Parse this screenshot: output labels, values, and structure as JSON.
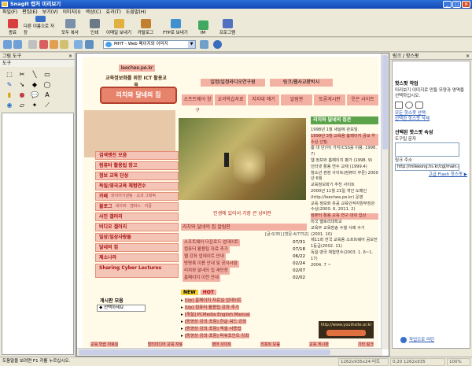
{
  "title": "SnagIt 캡처 미리보기",
  "window_buttons": [
    "_",
    "□",
    "×"
  ],
  "menu": [
    "파일(F)",
    "편집(E)",
    "보기(V)",
    "이미지(I)",
    "색상(C)",
    "효과(T)",
    "도움말(H)"
  ],
  "toolbar": {
    "buttons": [
      {
        "label": "종료",
        "icon": "exit-icon",
        "color": "#d84040"
      },
      {
        "label": "다른 이름으로 저장",
        "icon": "save-as-icon",
        "color": "#3a70c8"
      },
      {
        "label": "모두 복사",
        "icon": "copy-all-icon",
        "color": "#7a8fa8"
      },
      {
        "label": "인쇄",
        "icon": "print-icon",
        "color": "#6c7a88"
      },
      {
        "label": "이메일 보내기",
        "icon": "email-icon",
        "color": "#e0b040"
      },
      {
        "label": "카탈로그",
        "icon": "catalog-icon",
        "color": "#c08030"
      },
      {
        "label": "FTP로 보내기",
        "icon": "ftp-icon",
        "color": "#4090d0"
      },
      {
        "label": "IM",
        "icon": "im-icon",
        "color": "#40a860"
      },
      {
        "label": "프로그램",
        "icon": "program-icon",
        "color": "#5070c0"
      }
    ],
    "format_select": "MHT - Web 페이지와 이미지"
  },
  "left_panel": {
    "title": "그림 도구",
    "group": "도구",
    "tools": [
      "select-icon",
      "crop-icon",
      "line-icon",
      "rectangle-icon",
      "pencil-icon",
      "arrow-icon",
      "shape-icon",
      "ellipse-icon",
      "highlighter-icon",
      "stamp-icon",
      "callout-icon",
      "text-icon",
      "fill-icon",
      "eraser-icon",
      "magic-wand-icon",
      "eyedropper-icon",
      "color-icon",
      "more-icon"
    ]
  },
  "right_panel": {
    "title": "링크 / 핫스팟",
    "section1_title": "핫스팟 작업",
    "section1_desc": "미리보기 이미지로 만들 모양과 영역을 선택하십시오.",
    "links": [
      "모든 핫스팟 선택",
      "선택한 핫스팟 삭제"
    ],
    "section2_title": "선택된 핫스팟 속성",
    "tooltip_label": "도구팁 문자",
    "link_label": "링크 주소",
    "link_value": "http://mileeong.hs.kr/cgi/main.cgi?bl",
    "advanced": "고급 Flash 핫스팟 ▶",
    "footer_link": "작업으로 리턴"
  },
  "website": {
    "site_label": "leechee.pe.kr",
    "tagline": "교육정보화를 위한 ICT 활용교육",
    "logo": "리치와 달네의 집",
    "nav": [
      "일정/일정라디오연구원",
      "링크/웹사교환박시"
    ],
    "tabs": [
      "소프트웨어 창구",
      "교과학습자료",
      "지지대 얘기",
      "알림판",
      "토론게시판",
      "웃은 사이트"
    ],
    "left_menu": [
      "검색엔진 모음",
      "컴퓨터 활용팁 창고",
      "정보 교육 단상",
      "독일/영국교육 체험연수",
      "카페",
      "블로그",
      "사진 갤러리",
      "비디오 갤러리",
      "일상/일상사랑들",
      "달네의 집",
      "제소나라",
      "Sharing Cyber Lectures"
    ],
    "cafe_sub": "파이어가설팀 · 교과 그래픽",
    "blog_sub": "네이버 · 엠파스 · 이글",
    "bottom_select_label": "게시판 모음",
    "bottom_select_value": "◆ 선택하세요",
    "photo_caption": "인생에 있어서 가장 큰 낭비란",
    "notice_header": "리치와 달네의 집 알림판",
    "notice_counter": "[글:0/35] [방문:4/7752]",
    "notices": [
      {
        "t": "소프트웨어 다운로드 업데이트",
        "d": "07/31"
      },
      {
        "t": "컴퓨터 활용팁 자료 추가",
        "d": "07/18"
      },
      {
        "t": "웹 강좌 업데이트 안내",
        "d": "06/22"
      },
      {
        "t": "방명록 이용 안내 및 공지사항",
        "d": "02/24"
      },
      {
        "t": "리치와 달네의 집 새단장",
        "d": "02/07"
      },
      {
        "t": "홈페이지 이전 안내",
        "d": "02/02"
      }
    ],
    "new_hot": [
      "NEW",
      "HOT"
    ],
    "new_items": [
      "[Up] 홈페이지 자료실 업데이트",
      "[Up] 컴퓨터 활용팁 강좌 추가",
      "[개설] PCMedia English Manual",
      "[동영상 강의 포함] 한글 워드 강좌",
      "[동영상 강의 포함] 엑셀 사용법",
      "[동영상 강의 포함] 파워포인트 강좌"
    ],
    "profile_header": "리치와 달네의 집은",
    "profile": [
      "1998년 1월 새설에 관보임.",
      "1999년 3월 교육용 홈페이지 공모 우수상 선정.",
      "홈 대 단(어) 가지(CSS를 이용, 1998. 7)",
      "웹 정보와 홈페이지 평가 (1998. 9)",
      "인터넷 활용 연수 교재 (1999.4)",
      "청소년 권장 사이트(컴퓨터 부문) 2000년 6월",
      "교육정보화기 추천 사이트",
      "2000년 11월 21일 개인 도메인 (http://leechee.pe.kr) 운영",
      "교육 정보화 유공 교육인적자원부장관 수상(2000. 6, 2011. 2)",
      "컴퓨터 활용 교육 연구 대회 입상",
      "미국 멜로리대학교",
      "교육부 교육방송 수행 사례 수기 (2001. 10)",
      "제11회 전국 교육용 소프트웨어 공모전 1등급(2002. 11)",
      "독일·영국 체험연수(2003. 1. 6~1. 17)",
      "2004. 7 ~"
    ],
    "footer_links": [
      "교육 학습 자료실",
      "영어 사이트",
      "교육 게시판"
    ],
    "footer_links2": [
      "멀티미디어 교육 자료",
      "리포트 모음",
      "기타 링크"
    ],
    "banner": "http://www.youthsite.or.kr"
  },
  "status": {
    "message": "도움말을 보려면 F1 키를 누르십시오.",
    "dimensions": "1262x935x24-비트",
    "coords": "0,20  1262x935",
    "zoom": "100%"
  }
}
